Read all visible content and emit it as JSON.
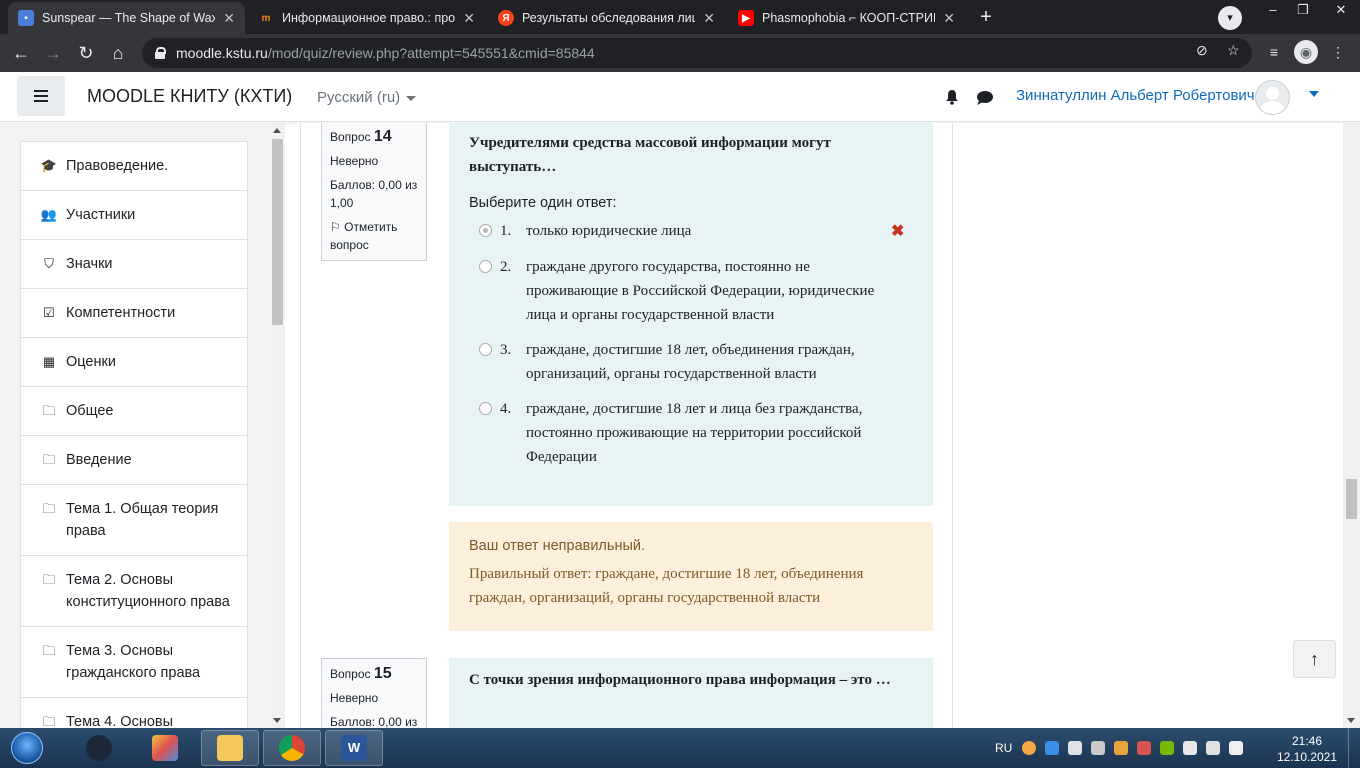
{
  "browser": {
    "tabs": [
      {
        "title": "Sunspear — The Shape of Wax",
        "icon": "chat-icon",
        "color": "#4a7fd9",
        "active": true
      },
      {
        "title": "Информационное право.: прос",
        "icon": "moodle-icon",
        "color": "#f98012",
        "active": false
      },
      {
        "title": "Результаты обследования лица,",
        "icon": "yandex-icon",
        "color": "#fc3f1d",
        "active": false
      },
      {
        "title": "Phasmophobia ⌐ КООП-СТРИМ",
        "icon": "youtube-icon",
        "color": "#ff0000",
        "active": false
      }
    ],
    "url_host": "moodle.kstu.ru",
    "url_path": "/mod/quiz/review.php?attempt=545551&cmid=85844"
  },
  "header": {
    "site_name": "MOODLE КНИТУ (КХТИ)",
    "language": "Русский (ru)",
    "user_name": "Зиннатуллин Альберт Робертович"
  },
  "nav": {
    "items": [
      {
        "label": "Правоведение.",
        "icon": "graduation-cap-icon",
        "glyph": "🎓"
      },
      {
        "label": "Участники",
        "icon": "users-icon",
        "glyph": "👥"
      },
      {
        "label": "Значки",
        "icon": "shield-icon",
        "glyph": "⛉"
      },
      {
        "label": "Компетентности",
        "icon": "checkbox-icon",
        "glyph": "☑"
      },
      {
        "label": "Оценки",
        "icon": "table-icon",
        "glyph": "▦"
      },
      {
        "label": "Общее",
        "icon": "folder-icon",
        "glyph": "🗀"
      },
      {
        "label": "Введение",
        "icon": "folder-icon",
        "glyph": "🗀"
      },
      {
        "label": "Тема 1. Общая теория права",
        "icon": "folder-icon",
        "glyph": "🗀"
      },
      {
        "label": "Тема 2. Основы конституционного права",
        "icon": "folder-icon",
        "glyph": "🗀"
      },
      {
        "label": "Тема 3. Основы гражданского права",
        "icon": "folder-icon",
        "glyph": "🗀"
      },
      {
        "label": "Тема 4. Основы",
        "icon": "folder-icon",
        "glyph": "🗀"
      }
    ]
  },
  "q14": {
    "label": "Вопрос",
    "number": "14",
    "state": "Неверно",
    "marks": "Баллов: 0,00 из 1,00",
    "flag": "Отметить вопрос",
    "text": "Учредителями средства массовой информации могут выступать…",
    "prompt": "Выберите один ответ:",
    "answers": [
      {
        "num": "1.",
        "text": "только юридические лица",
        "checked": true,
        "wrong": true
      },
      {
        "num": "2.",
        "text": "граждане другого государства, постоянно не проживающие в Российской Федерации, юридические лица и органы государственной власти",
        "checked": false,
        "wrong": false
      },
      {
        "num": "3.",
        "text": "граждане, достигшие 18 лет, объединения граждан, организаций, органы государственной власти",
        "checked": false,
        "wrong": false
      },
      {
        "num": "4.",
        "text": "граждане, достигшие 18 лет и лица без гражданства, постоянно проживающие на территории российской Федерации",
        "checked": false,
        "wrong": false
      }
    ],
    "feedback_state": "Ваш ответ неправильный.",
    "feedback_right": "Правильный ответ: граждане, достигшие 18 лет, объединения граждан, организаций, органы государственной власти"
  },
  "q15": {
    "label": "Вопрос",
    "number": "15",
    "state": "Неверно",
    "marks": "Баллов: 0,00 из",
    "text": "С точки зрения информационного права информация – это …"
  },
  "taskbar": {
    "language": "RU",
    "time": "21:46",
    "date": "12.10.2021"
  }
}
